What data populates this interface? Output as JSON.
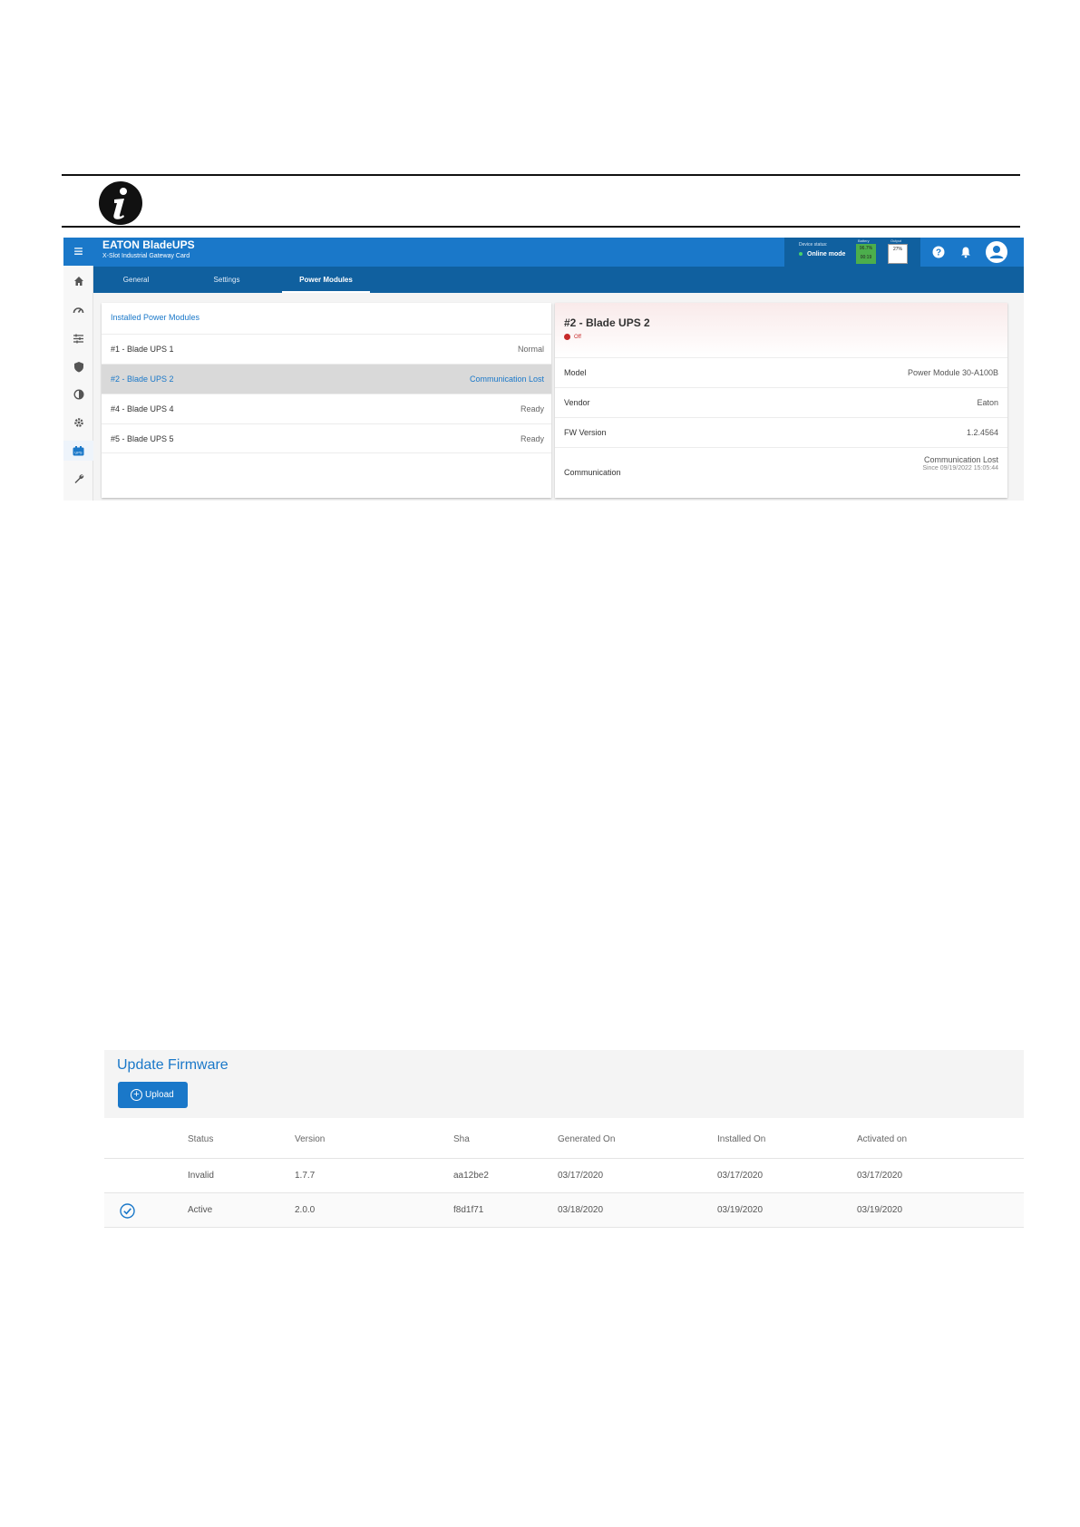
{
  "screenshot1": {
    "app": {
      "title": "EATON BladeUPS",
      "subtitle": "X-Slot Industrial Gateway Card"
    },
    "device_status": {
      "label": "Device status:",
      "mode": "Online mode"
    },
    "battery": {
      "label": "Battery",
      "percent": "96.7%",
      "runtime": "00:19"
    },
    "output": {
      "label": "Output",
      "percent": "27%"
    },
    "tabs": [
      {
        "label": "General"
      },
      {
        "label": "Settings"
      },
      {
        "label": "Power Modules"
      }
    ],
    "active_tab": "Power Modules",
    "sidebar_icons": [
      "home-icon",
      "dashboard-icon",
      "sliders-icon",
      "shield-icon",
      "contrast-icon",
      "gear-icon",
      "ups-icon",
      "wrench-icon"
    ],
    "modules_panel": {
      "title": "Installed Power Modules",
      "items": [
        {
          "name": "#1  -  Blade UPS 1",
          "status": "Normal"
        },
        {
          "name": "#2  -  Blade UPS 2",
          "status": "Communication Lost"
        },
        {
          "name": "#4  -  Blade UPS 4",
          "status": "Ready"
        },
        {
          "name": "#5  -  Blade UPS 5",
          "status": "Ready"
        }
      ],
      "selected_index": 1
    },
    "detail_panel": {
      "title": "#2 - Blade UPS 2",
      "state": "Off",
      "rows": [
        {
          "key": "Model",
          "value": "Power Module 30-A100B"
        },
        {
          "key": "Vendor",
          "value": "Eaton"
        },
        {
          "key": "FW Version",
          "value": "1.2.4564"
        }
      ],
      "communication": {
        "key": "Communication",
        "value": "Communication Lost",
        "since": "Since 09/19/2022 15:05:44"
      }
    },
    "colors": {
      "primary": "#1a78c9",
      "dark": "#10609f",
      "error": "#c62828",
      "ok": "#4cae4c"
    }
  },
  "screenshot2": {
    "title": "Update Firmware",
    "upload_label": "Upload",
    "columns": [
      "Status",
      "Version",
      "Sha",
      "Generated On",
      "Installed On",
      "Activated on"
    ],
    "rows": [
      {
        "active": false,
        "cells": [
          "Invalid",
          "1.7.7",
          "aa12be2",
          "03/17/2020",
          "03/17/2020",
          "03/17/2020"
        ]
      },
      {
        "active": true,
        "cells": [
          "Active",
          "2.0.0",
          "f8d1f71",
          "03/18/2020",
          "03/19/2020",
          "03/19/2020"
        ]
      }
    ]
  }
}
